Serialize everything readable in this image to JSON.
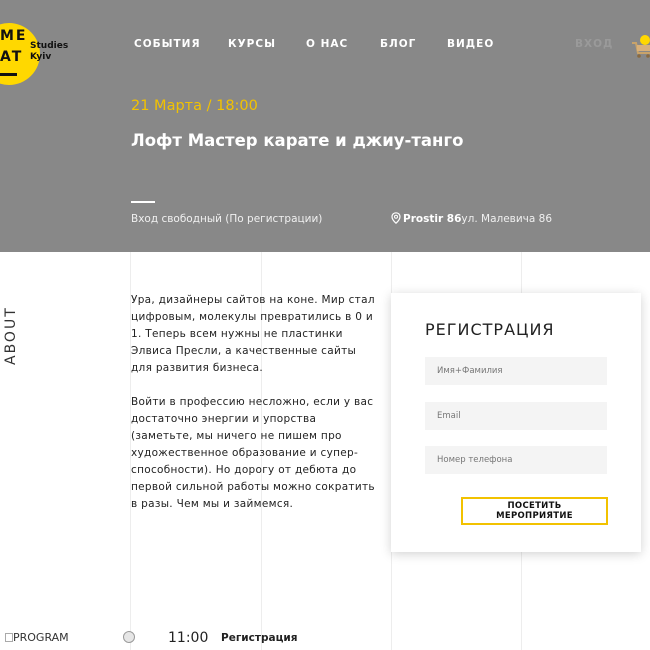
{
  "logo": {
    "line1": "ME",
    "line2": "AT",
    "studio": "Studies",
    "city": "Kyiv"
  },
  "nav": {
    "items": [
      {
        "label": "СОБЫТИЯ"
      },
      {
        "label": "КУРСЫ"
      },
      {
        "label": "О НАС"
      },
      {
        "label": "БЛОГ"
      },
      {
        "label": "ВИДЕО"
      }
    ],
    "faded_label": "ВХОД",
    "cart_icon": "cart-icon"
  },
  "event": {
    "date": "21 Марта / 18:00",
    "title": "Лофт Мастер карате и джиу-танго",
    "entry": "Вход свободный (По регистрации)",
    "venue_name": "Prostir 86",
    "venue_address": "ул. Малевича 86",
    "venue_icon": "location-pin-icon"
  },
  "about": {
    "label": "ABOUT",
    "paragraphs": [
      "Ура, дизайнеры сайтов на коне. Мир стал цифровым, молекулы превратились в 0 и 1. Теперь всем нужны не пластинки Элвиса Пресли, а качественные сайты для развития бизнеса.",
      "Войти в профессию несложно, если у вас достаточно энергии и упорства (заметьте, мы ничего не пишем про художественное образование и супер-способности). Но дорогу от дебюта до первой сильной работы можно сократить в разы. Чем мы и займемся."
    ]
  },
  "registration": {
    "title": "РЕГИСТРАЦИЯ",
    "name_placeholder": "Имя+Фамилия",
    "email_placeholder": "Email",
    "phone_placeholder": "Номер телефона",
    "submit_label": "ПОСЕТИТЬ МЕРОПРИЯТИЕ"
  },
  "program": {
    "image_alt": "PROGRAM",
    "time": "11:00",
    "item": "Регистрация"
  },
  "colors": {
    "hero_bg": "#888888",
    "accent": "#f2c200",
    "logo_yellow": "#ffd800"
  }
}
